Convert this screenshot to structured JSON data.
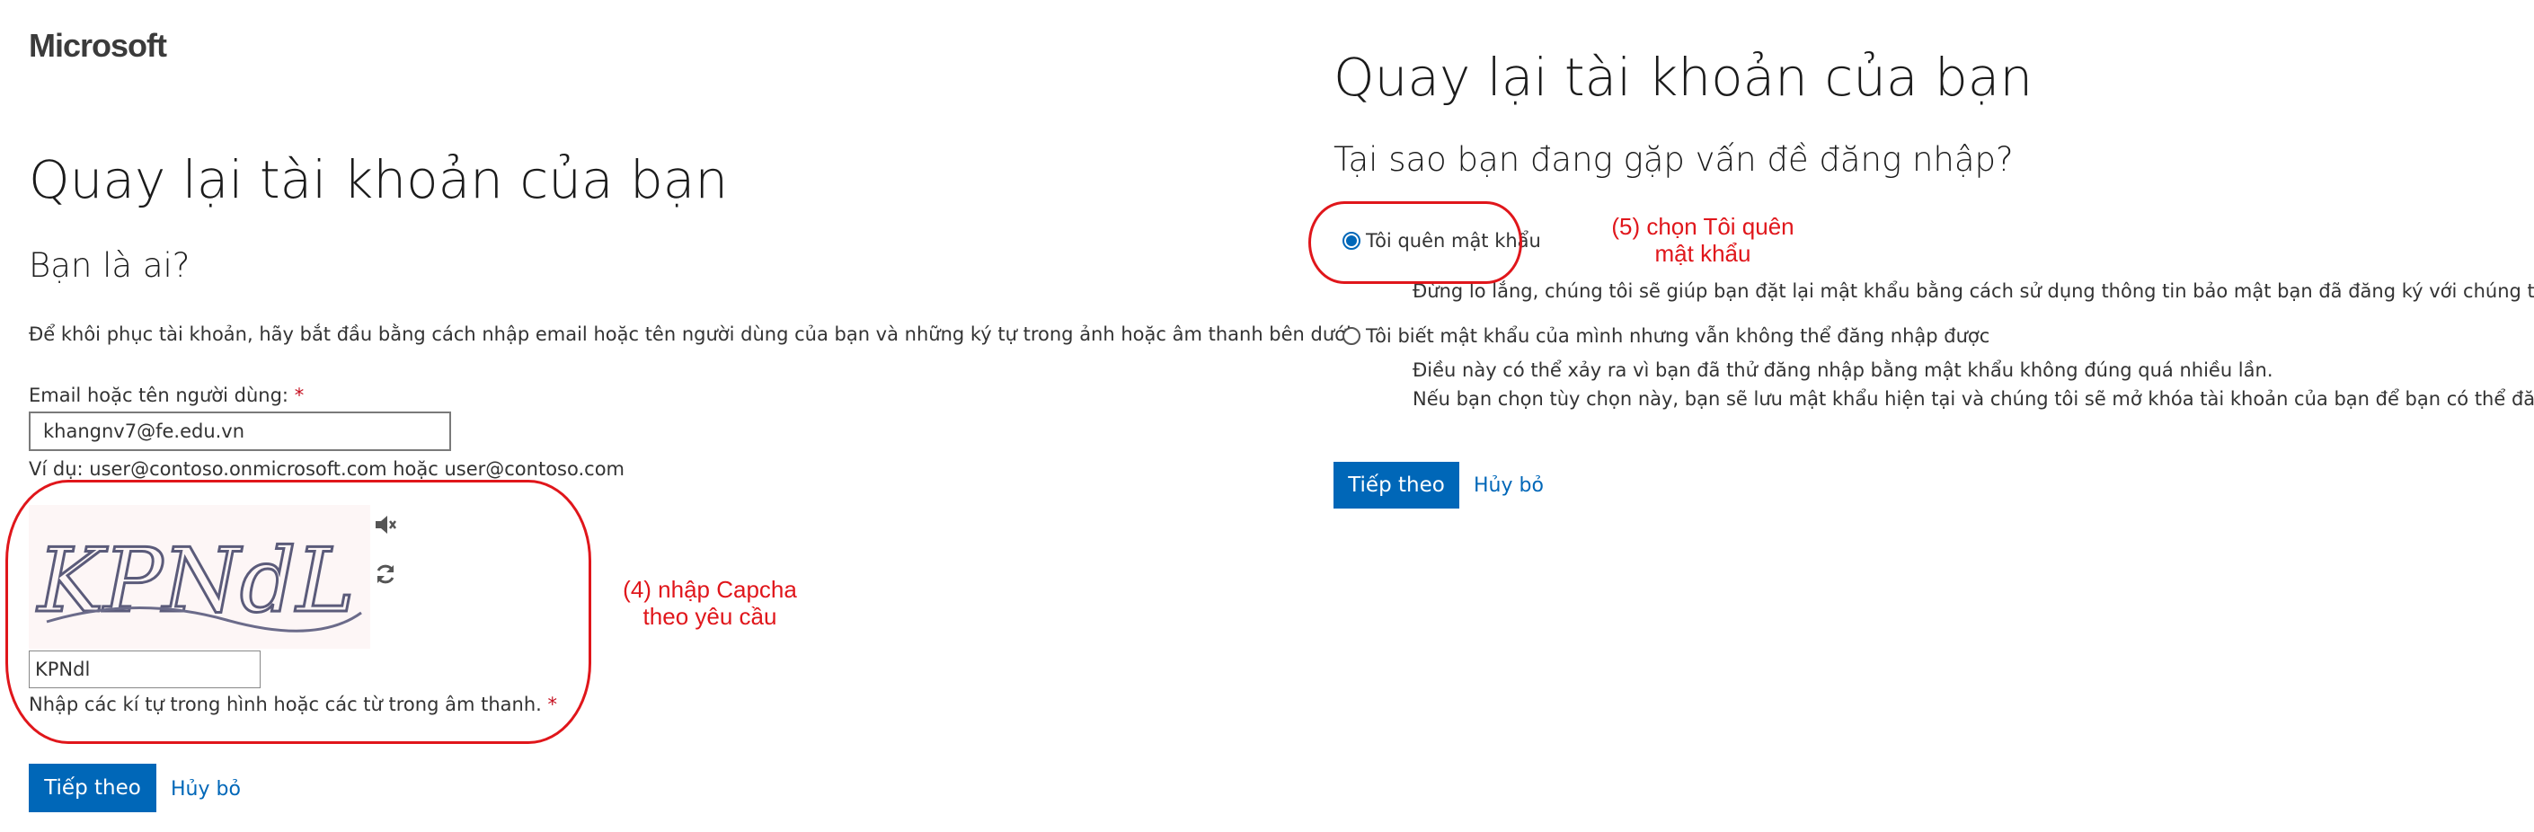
{
  "left": {
    "logo": "Microsoft",
    "title": "Quay lại tài khoản của bạn",
    "subtitle": "Bạn là ai?",
    "instructions": "Để khôi phục tài khoản, hãy bắt đầu bằng cách nhập email hoặc tên người dùng của bạn và những ký tự trong ảnh hoặc âm thanh bên dưới.",
    "email_label": "Email hoặc tên người dùng:",
    "required_mark": "*",
    "email_value": "khangnv7@fe.edu.vn",
    "email_example": "Ví dụ: user@contoso.onmicrosoft.com hoặc user@contoso.com",
    "captcha_image_text": "KPNdL",
    "captcha_value": "KPNdl",
    "captcha_hint": "Nhập các kí tự trong hình hoặc các từ trong âm thanh.",
    "next_button": "Tiếp theo",
    "cancel_link": "Hủy bỏ",
    "annotation_line1": "(4) nhập Capcha",
    "annotation_line2": "theo yêu cầu"
  },
  "right": {
    "title": "Quay lại tài khoản của bạn",
    "subtitle": "Tại sao bạn đang gặp vấn đề đăng nhập?",
    "option1_label": "Tôi quên mật khẩu",
    "option1_desc": "Đừng lo lắng, chúng tôi sẽ giúp bạn đặt lại mật khẩu bằng cách sử dụng thông tin bảo mật bạn đã đăng ký với chúng tôi.",
    "option2_label": "Tôi biết mật khẩu của mình nhưng vẫn không thể đăng nhập được",
    "option2_desc1": "Điều này có thể xảy ra vì bạn đã thử đăng nhập bằng mật khẩu không đúng quá nhiều lần.",
    "option2_desc2": "Nếu bạn chọn tùy chọn này, bạn sẽ lưu mật khẩu hiện tại và chúng tôi sẽ mở khóa tài khoản của bạn để bạn có thể đăng nhập lại.",
    "next_button": "Tiếp theo",
    "cancel_link": "Hủy bỏ",
    "annotation_line1": "(5) chọn Tôi quên",
    "annotation_line2": "mật khẩu",
    "selected_option": 1
  },
  "colors": {
    "accent": "#0067b8",
    "annotation": "#e0161b",
    "required": "#c50f1f"
  },
  "icons": {
    "audio": "speaker-icon",
    "refresh": "refresh-icon"
  }
}
